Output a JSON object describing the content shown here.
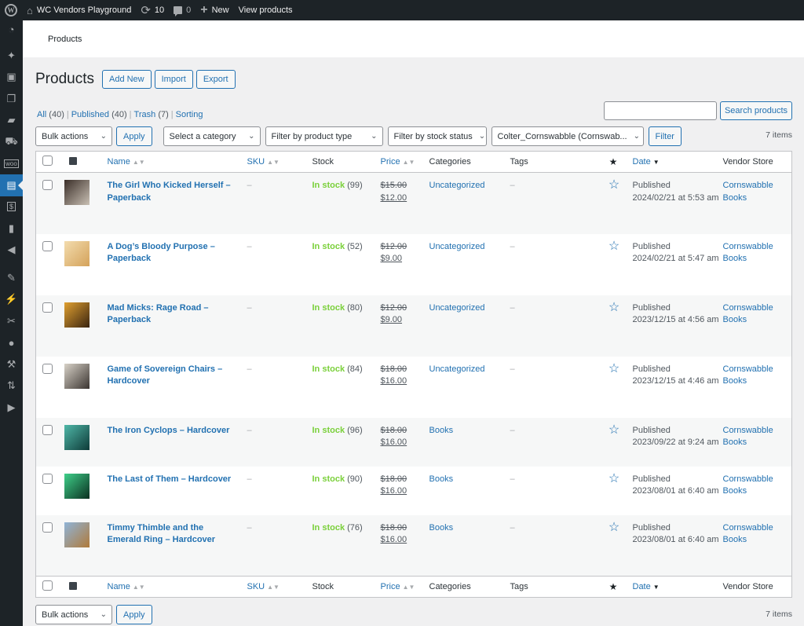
{
  "adminbar": {
    "site_name": "WC Vendors Playground",
    "updates_count": "10",
    "comments_count": "0",
    "new_label": "New",
    "view_products_label": "View products"
  },
  "sidebar": {
    "items": [
      {
        "icon": "dashboard-icon",
        "glyph": "◔"
      },
      {
        "icon": "pin-icon",
        "glyph": "📌"
      },
      {
        "icon": "media-icon",
        "glyph": "▣"
      },
      {
        "icon": "pages-icon",
        "glyph": "❐"
      },
      {
        "icon": "comments-icon",
        "glyph": "▰"
      },
      {
        "icon": "cart-icon",
        "glyph": "🛒"
      },
      {
        "icon": "woocommerce-icon",
        "glyph": "▭"
      },
      {
        "icon": "products-icon",
        "glyph": "▤",
        "active": true
      },
      {
        "icon": "payments-icon",
        "glyph": "$"
      },
      {
        "icon": "analytics-icon",
        "glyph": "▮"
      },
      {
        "icon": "marketing-icon",
        "glyph": "📣"
      },
      {
        "icon": "appearance-icon",
        "glyph": "✎"
      },
      {
        "icon": "plugins-icon",
        "glyph": "⚡"
      },
      {
        "icon": "scissors-icon",
        "glyph": "✂"
      },
      {
        "icon": "users-icon",
        "glyph": "●"
      },
      {
        "icon": "tools-icon",
        "glyph": "🔧"
      },
      {
        "icon": "settings-icon",
        "glyph": "⇅"
      },
      {
        "icon": "play-icon",
        "glyph": "▶"
      }
    ]
  },
  "header": {
    "title": "Products"
  },
  "page": {
    "title": "Products",
    "add_new": "Add New",
    "import": "Import",
    "export": "Export",
    "views": {
      "all": "All",
      "all_count": "(40)",
      "published": "Published",
      "published_count": "(40)",
      "trash": "Trash",
      "trash_count": "(7)",
      "sorting": "Sorting"
    },
    "search": {
      "value": "",
      "placeholder": "",
      "button": "Search products"
    },
    "filters": {
      "bulk_actions": "Bulk actions",
      "apply": "Apply",
      "category": "Select a category",
      "product_type": "Filter by product type",
      "stock_status": "Filter by stock status",
      "vendor": "Colter_Cornswabble (Cornswab...",
      "filter": "Filter"
    },
    "items_count": "7 items"
  },
  "table": {
    "columns": {
      "name": "Name",
      "sku": "SKU",
      "stock": "Stock",
      "price": "Price",
      "categories": "Categories",
      "tags": "Tags",
      "featured": "★",
      "date": "Date",
      "vendor": "Vendor Store"
    },
    "rows": [
      {
        "name": "The Girl Who Kicked Herself – Paperback",
        "sku": "–",
        "stock": "In stock",
        "qty": "(99)",
        "old_price": "$15.00",
        "price": "$12.00",
        "category": "Uncategorized",
        "tags": "–",
        "status": "Published",
        "date": "2024/02/21 at 5:53 am",
        "vendor": "Cornswabble Books",
        "thumb": [
          "#3a2e28",
          "#c9c0b4"
        ]
      },
      {
        "name": "A Dog’s Bloody Purpose – Paperback",
        "sku": "–",
        "stock": "In stock",
        "qty": "(52)",
        "old_price": "$12.00",
        "price": "$9.00",
        "category": "Uncategorized",
        "tags": "–",
        "status": "Published",
        "date": "2024/02/21 at 5:47 am",
        "vendor": "Cornswabble Books",
        "thumb": [
          "#f3dcae",
          "#d4a25a"
        ]
      },
      {
        "name": "Mad Micks: Rage Road – Paperback",
        "sku": "–",
        "stock": "In stock",
        "qty": "(80)",
        "old_price": "$12.00",
        "price": "$9.00",
        "category": "Uncategorized",
        "tags": "–",
        "status": "Published",
        "date": "2023/12/15 at 4:56 am",
        "vendor": "Cornswabble Books",
        "thumb": [
          "#e0a030",
          "#3a2410"
        ]
      },
      {
        "name": "Game of Sovereign Chairs – Hardcover",
        "sku": "–",
        "stock": "In stock",
        "qty": "(84)",
        "old_price": "$18.00",
        "price": "$16.00",
        "category": "Uncategorized",
        "tags": "–",
        "status": "Published",
        "date": "2023/12/15 at 4:46 am",
        "vendor": "Cornswabble Books",
        "thumb": [
          "#d8d2c8",
          "#3a3430"
        ]
      },
      {
        "name": "The Iron Cyclops – Hardcover",
        "sku": "–",
        "stock": "In stock",
        "qty": "(96)",
        "old_price": "$18.00",
        "price": "$16.00",
        "category": "Books",
        "tags": "–",
        "status": "Published",
        "date": "2023/09/22 at 9:24 am",
        "vendor": "Cornswabble Books",
        "thumb": [
          "#4fb8a8",
          "#0e3a38"
        ]
      },
      {
        "name": "The Last of Them – Hardcover",
        "sku": "–",
        "stock": "In stock",
        "qty": "(90)",
        "old_price": "$18.00",
        "price": "$16.00",
        "category": "Books",
        "tags": "–",
        "status": "Published",
        "date": "2023/08/01 at 6:40 am",
        "vendor": "Cornswabble Books",
        "thumb": [
          "#3fd08a",
          "#0a3020"
        ]
      },
      {
        "name": "Timmy Thimble and the Emerald Ring – Hardcover",
        "sku": "–",
        "stock": "In stock",
        "qty": "(76)",
        "old_price": "$18.00",
        "price": "$16.00",
        "category": "Books",
        "tags": "–",
        "status": "Published",
        "date": "2023/08/01 at 6:40 am",
        "vendor": "Cornswabble Books",
        "thumb": [
          "#8fb4d8",
          "#b07a3a"
        ]
      }
    ]
  },
  "colors": {
    "accent": "#2271b1",
    "instock": "#7ad03a",
    "adminbar": "#1d2327"
  }
}
